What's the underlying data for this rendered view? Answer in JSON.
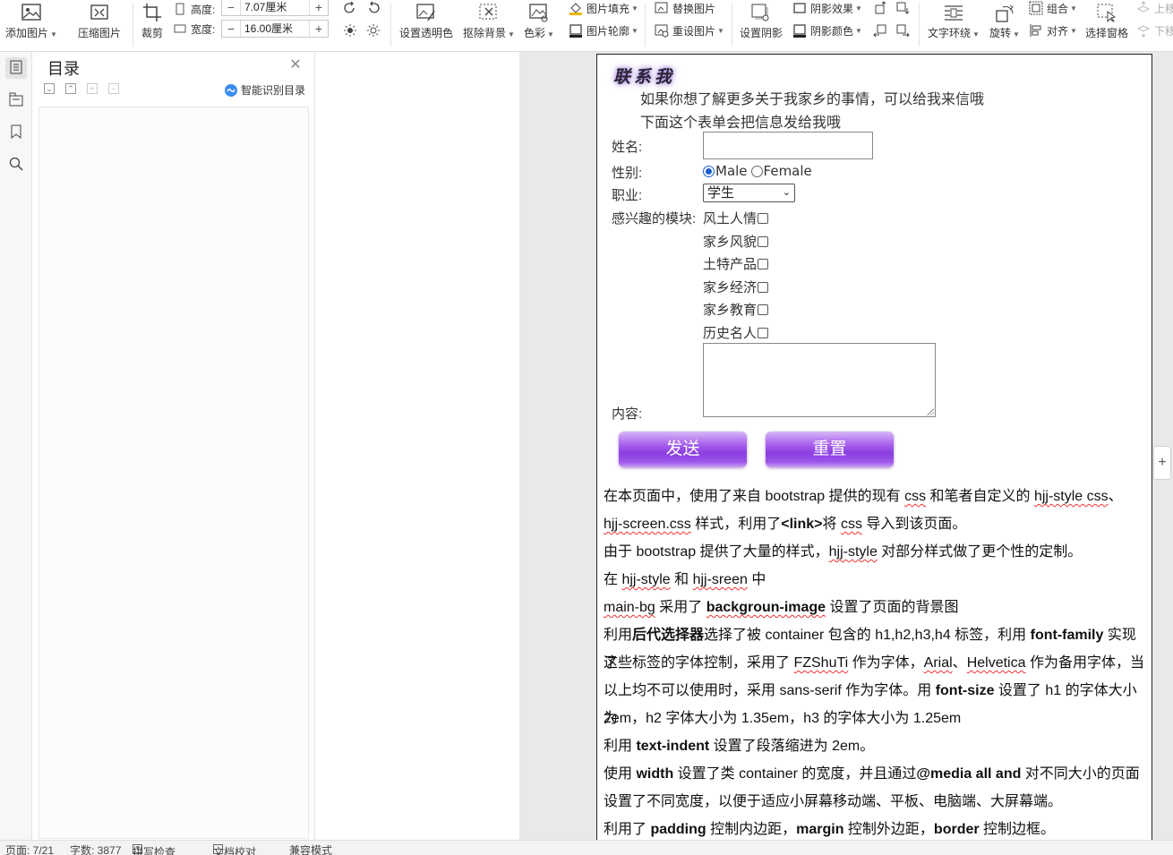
{
  "ribbon": {
    "add_image": "添加图片",
    "compress_image": "压缩图片",
    "crop": "裁剪",
    "height_label": "高度:",
    "height_value": "7.07厘米",
    "width_label": "宽度:",
    "width_value": "16.00厘米",
    "set_transparent": "设置透明色",
    "remove_bg": "抠除背景",
    "color": "色彩",
    "image_fill": "图片填充",
    "image_outline": "图片轮廓",
    "replace_image": "替换图片",
    "reset_image": "重设图片",
    "set_shadow": "设置阴影",
    "shadow_effect": "阴影效果",
    "shadow_color": "阴影颜色",
    "text_wrap": "文字环绕",
    "rotate": "旋转",
    "group": "组合",
    "align": "对齐",
    "selection_pane": "选择窗格",
    "move_up": "上移",
    "move_down": "下移"
  },
  "toc": {
    "title": "目录",
    "smart_recognize": "智能识别目录"
  },
  "document": {
    "logo_text": "联系我",
    "intro_1": "如果你想了解更多关于我家乡的事情，可以给我来信哦",
    "intro_2": "下面这个表单会把信息发给我哦",
    "form": {
      "name_label": "姓名:",
      "gender_label": "性别:",
      "male": "Male",
      "female": "Female",
      "job_label": "职业:",
      "job_value": "学生",
      "interest_label": "感兴趣的模块:",
      "interests": [
        "风土人情",
        "家乡风貌",
        "土特产品",
        "家乡经济",
        "家乡教育",
        "历史名人"
      ],
      "content_label": "内容:",
      "send_button": "发送",
      "reset_button": "重置"
    },
    "paragraphs": {
      "p1_a": "在本页面中，使用了来自 bootstrap 提供的现有 ",
      "p1_css": "css",
      "p1_b": " 和笔者自定义的 ",
      "p1_hjj": "hjj-style css",
      "p1_c": "、",
      "p2_hjj": "hjj-screen.css",
      "p2_a": " 样式，利用了",
      "p2_link": "<link>",
      "p2_b": "将 ",
      "p2_css": "css",
      "p2_c": " 导入到该页面。",
      "p3_a": "由于 bootstrap 提供了大量的样式，",
      "p3_hjj": "hjj-style",
      "p3_b": " 对部分样式做了更个性的定制。",
      "p4_a": "在 ",
      "p4_hjj1": "hjj-style",
      "p4_b": " 和 ",
      "p4_hjj2": "hjj-sreen",
      "p4_c": " 中",
      "p5_mainbg": "main-bg",
      "p5_a": " 采用了 ",
      "p5_bgimg": "backgroun-image",
      "p5_b": " 设置了页面的背景图",
      "p6_a": "利用",
      "p6_selector": "后代选择器",
      "p6_b": "选择了被 container 包含的 h1,h2,h3,h4 标签，利用 ",
      "p6_ff": "font-family",
      "p6_c": " 实现了",
      "p7_a": "这些标签的字体控制，采用了 ",
      "p7_fzshuti": "FZShuTi",
      "p7_b": " 作为字体，",
      "p7_arial": "Arial",
      "p7_c": "、",
      "p7_helvetica": "Helvetica",
      "p7_d": " 作为备用字体，当",
      "p8_a": "以上均不可以使用时，采用 sans-serif 作为字体。用 ",
      "p8_fs": "font-size",
      "p8_b": " 设置了 h1 的字体大小为",
      "p9": "2em，h2 字体大小为 1.35em，h3 的字体大小为 1.25em",
      "p10_a": "利用 ",
      "p10_ti": "text-indent",
      "p10_b": " 设置了段落缩进为 2em。",
      "p11_a": "使用 ",
      "p11_width": "width",
      "p11_b": " 设置了类 container 的宽度，并且通过",
      "p11_media": "@media all and",
      "p11_c": " 对不同大小的页面",
      "p12": "设置了不同宽度，以便于适应小屏幕移动端、平板、电脑端、大屏幕端。",
      "p13_a": "利用了 ",
      "p13_padding": "padding",
      "p13_b": " 控制内边距，",
      "p13_margin": "margin",
      "p13_c": " 控制外边距，",
      "p13_border": "border",
      "p13_d": " 控制边框。"
    }
  },
  "status": {
    "page": "页面: 7/21",
    "word_count": "字数: 3877",
    "spell_check": "拼写检查",
    "doc_check": "文档校对",
    "compat_mode": "兼容模式"
  },
  "colors": {
    "button_purple": "#8a3ee0",
    "radio_blue": "#1a5fd0",
    "spell_underline": "#e33"
  }
}
